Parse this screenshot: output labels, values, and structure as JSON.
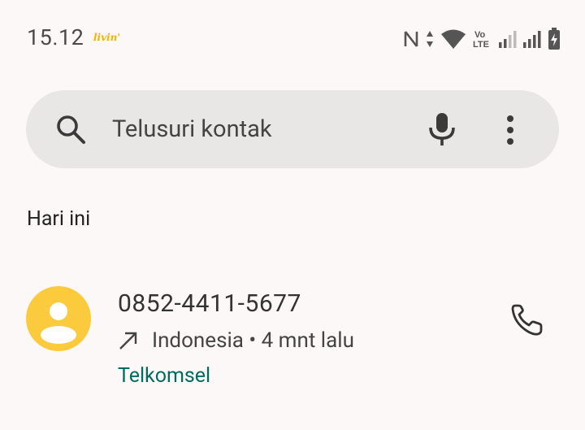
{
  "status_bar": {
    "time": "15.12",
    "app_badge": "livin'",
    "icons": [
      "nfc-icon",
      "data-arrows-icon",
      "wifi-icon",
      "volte-icon",
      "signal-icon",
      "signal-icon",
      "battery-charging-icon"
    ],
    "volte_text_top": "Vo",
    "volte_text_bottom": "LTE"
  },
  "search": {
    "placeholder": "Telusuri kontak",
    "icons": [
      "search-icon",
      "mic-icon",
      "more-vert-icon"
    ]
  },
  "recents": {
    "section_header": "Hari ini",
    "calls": [
      {
        "number": "0852-4411-5677",
        "direction_icon": "outgoing-arrow-icon",
        "location": "Indonesia",
        "separator": " • ",
        "time": "4 mnt lalu",
        "carrier": "Telkomsel",
        "action_icon": "phone-icon"
      }
    ]
  },
  "colors": {
    "background": "#fcf8f8",
    "search_bar": "#e9e6e6",
    "avatar": "#fbcb3d",
    "carrier_text": "#006b5f"
  }
}
